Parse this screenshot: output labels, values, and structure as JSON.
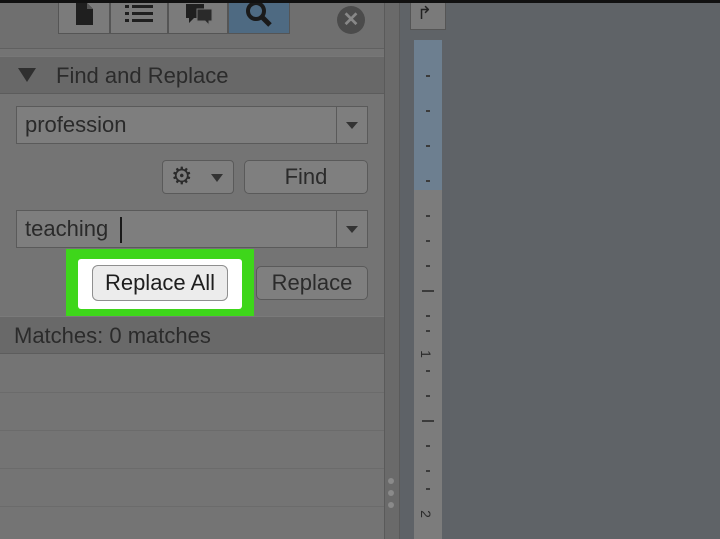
{
  "toolbar": {
    "tabs": [
      {
        "icon": "document-icon"
      },
      {
        "icon": "list-icon"
      },
      {
        "icon": "comments-icon"
      },
      {
        "icon": "search-icon",
        "active": true
      }
    ],
    "close_icon": "close-icon"
  },
  "find_replace": {
    "title": "Find and Replace",
    "find_value": "profession",
    "find_button": "Find",
    "replace_value": "teaching",
    "replace_all_button": "Replace All",
    "replace_button": "Replace",
    "matches_text": "Matches: 0 matches"
  },
  "ruler": {
    "labels": [
      "1",
      "2"
    ]
  },
  "colors": {
    "highlight": "#3ed61a",
    "active_tab": "#4e6a82"
  }
}
